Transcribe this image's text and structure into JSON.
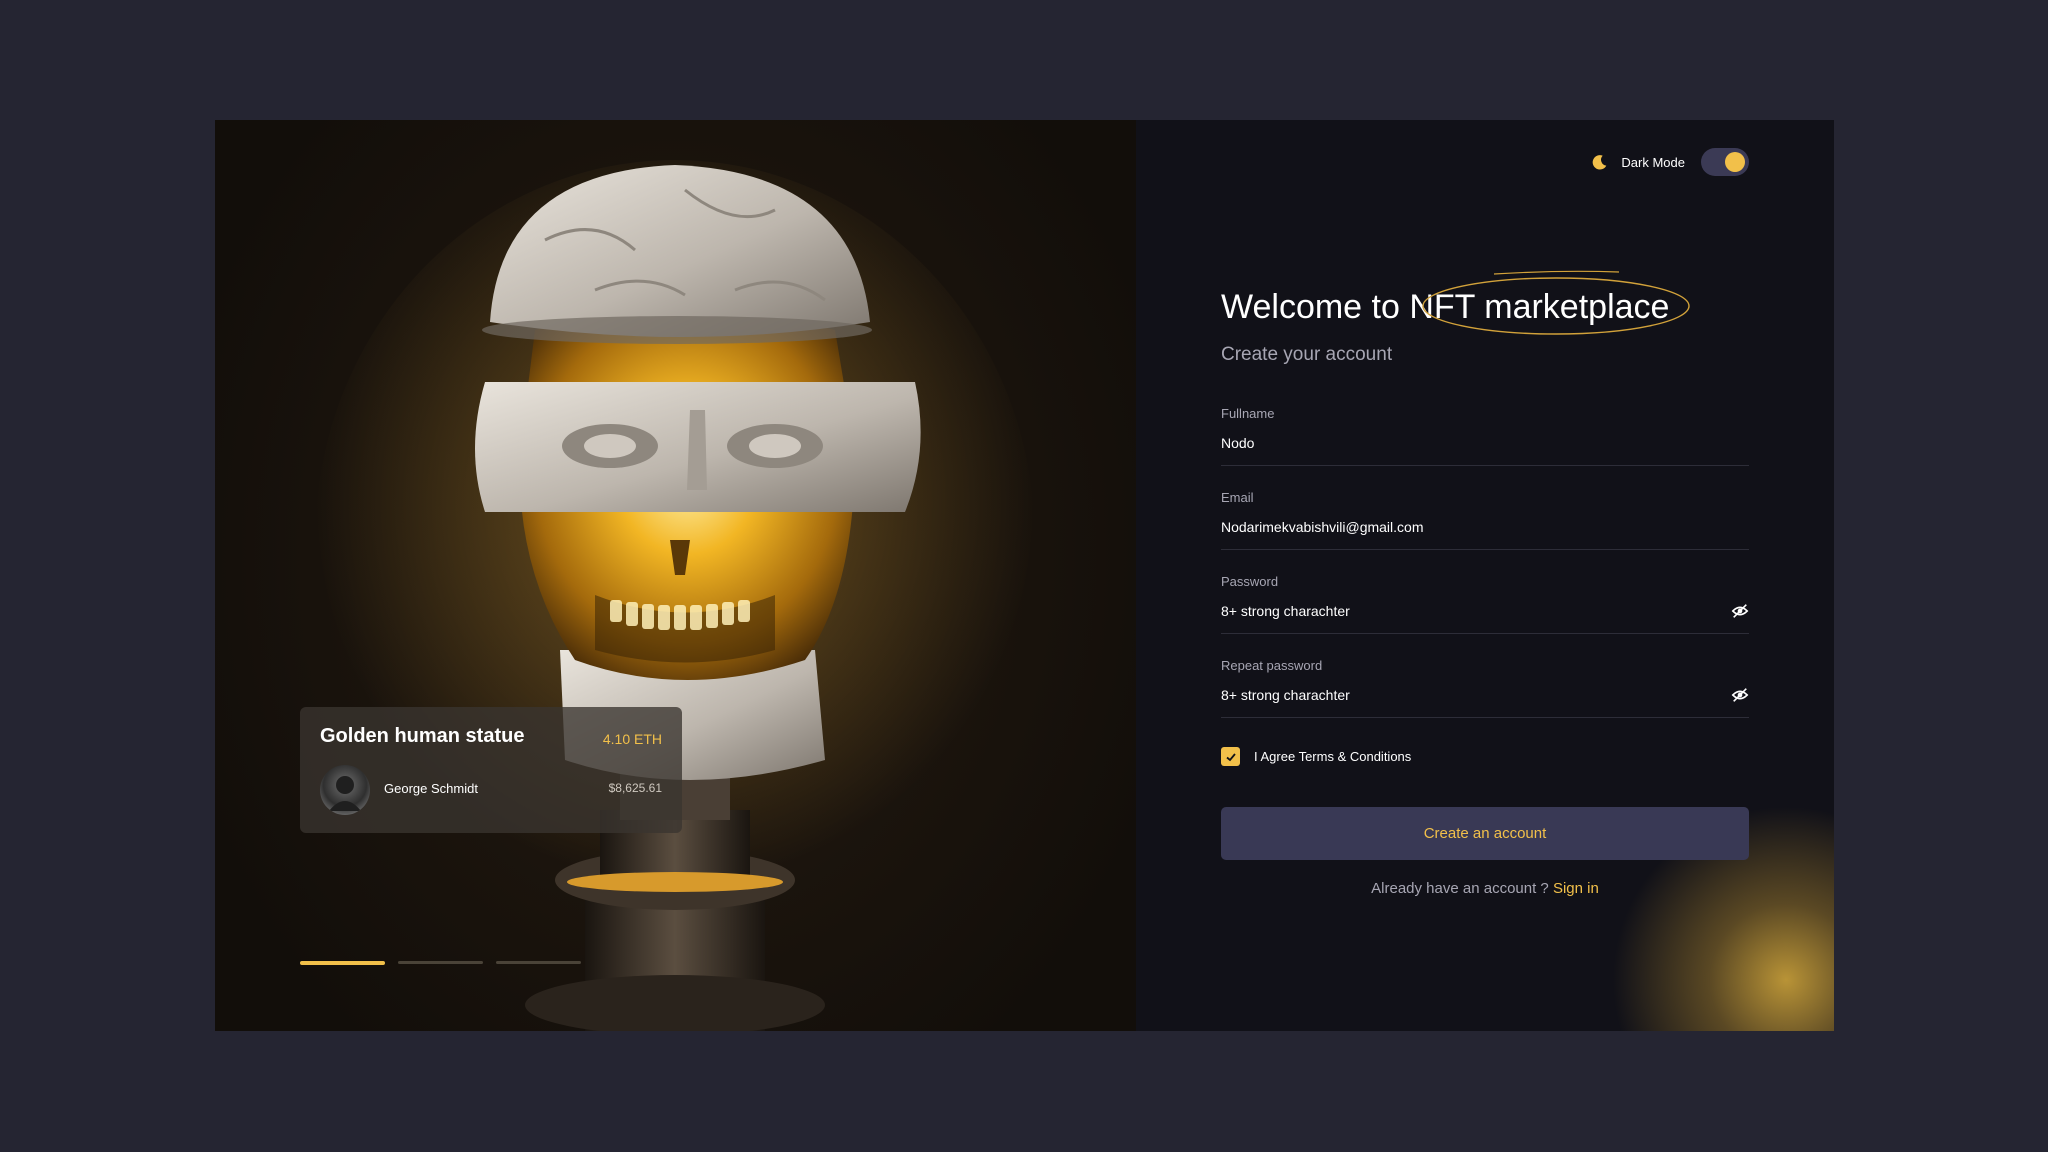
{
  "colors": {
    "accent": "#f2c04a",
    "page_background": "#252532",
    "panel_background": "#111118",
    "button_background": "#393955"
  },
  "nft_card": {
    "title": "Golden human statue",
    "price_eth": "4.10 ETH",
    "owner": "George Schmidt",
    "price_usd": "$8,625.61"
  },
  "carousel": {
    "slide_count": 3,
    "active_index": 0
  },
  "header": {
    "icon": "moon-icon",
    "dark_mode_label": "Dark Mode",
    "dark_mode_on": true
  },
  "form": {
    "heading": "Welcome to NFT marketplace",
    "subtitle": "Create your account",
    "fields": [
      {
        "label": "Fullname",
        "value": "Nodo"
      },
      {
        "label": "Email",
        "value": "Nodarimekvabishvili@gmail.com"
      },
      {
        "label": "Password",
        "value": "8+ strong charachter",
        "icon": "eye-off-icon"
      },
      {
        "label": "Repeat password",
        "value": "8+ strong charachter",
        "icon": "eye-off-icon"
      }
    ],
    "terms_label": "I Agree Terms & Conditions",
    "terms_checked": true,
    "submit_label": "Create an account",
    "signin_prompt": "Already have an account ?",
    "signin_link": "Sign in"
  }
}
